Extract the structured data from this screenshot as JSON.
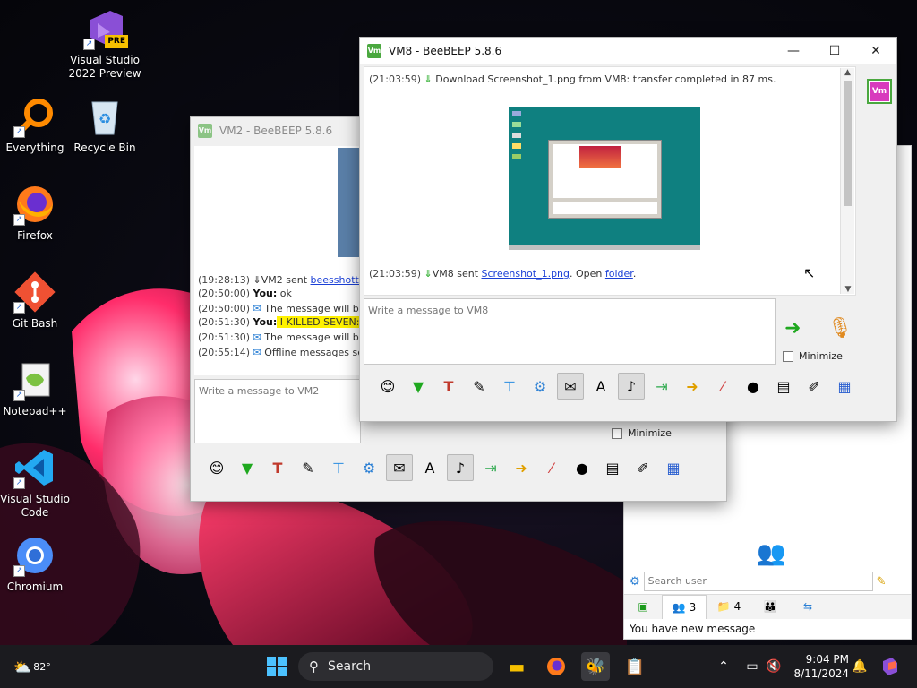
{
  "desktop": {
    "icons": [
      {
        "label": "Visual Studio 2022 Preview",
        "icon": "visual-studio-icon"
      },
      {
        "label": "Everything",
        "icon": "everything-search-icon"
      },
      {
        "label": "Recycle Bin",
        "icon": "recycle-bin-icon"
      },
      {
        "label": "Firefox",
        "icon": "firefox-icon"
      },
      {
        "label": "Git Bash",
        "icon": "git-bash-icon"
      },
      {
        "label": "Notepad++",
        "icon": "notepadpp-icon"
      },
      {
        "label": "Visual Studio Code",
        "icon": "vscode-icon"
      },
      {
        "label": "Chromium",
        "icon": "chromium-icon"
      }
    ],
    "vs_badge": "PRE"
  },
  "vm2_window": {
    "title": "VM2 - BeeBEEP 5.8.6",
    "messages": [
      {
        "time": "(19:28:13)",
        "prefix": "VM2 sent ",
        "link": "beesshottmp"
      },
      {
        "time": "(20:50:00)",
        "you": "You:",
        "text": " ok"
      },
      {
        "time": "(20:50:00)",
        "text": "The message will be de"
      },
      {
        "time": "(20:51:30)",
        "you": "You:",
        "highlight": " I KILLED SEVEN:50 C"
      },
      {
        "time": "(20:51:30)",
        "text": "The message will be de"
      },
      {
        "time": "(20:55:14)",
        "text": "Offline messages sent"
      }
    ],
    "input_placeholder": "Write a message to VM2",
    "minimize_label": "Minimize"
  },
  "vm8_window": {
    "title": "VM8 - BeeBEEP 5.8.6",
    "app_badge": "Vm",
    "controls": {
      "minimize": "—",
      "maximize": "☐",
      "close": "✕"
    },
    "messages": [
      {
        "time": "(21:03:59)",
        "text": "Download Screenshot_1.png from VM8: transfer completed in 87 ms."
      },
      {
        "time": "(21:03:59)",
        "prefix": "VM8 sent ",
        "link": "Screenshot_1.png",
        "middle": ". Open ",
        "link2": "folder",
        "suffix": "."
      }
    ],
    "input_placeholder": "Write a message to VM8",
    "minimize_label": "Minimize",
    "toolbar": [
      "smiley-icon",
      "green-arrow-down-icon",
      "text-format-icon",
      "color-pen-icon",
      "paint-brush-icon",
      "settings-gear-icon",
      "envelope-icon",
      "font-icon",
      "note-icon",
      "send-file-icon",
      "folder-icon",
      "html-tag-icon",
      "webcam-icon",
      "screenshot-icon",
      "notes-icon",
      "save-icon"
    ]
  },
  "main_panel": {
    "search_placeholder": "Search user",
    "tabs": [
      {
        "icon": "chat-icon",
        "label": ""
      },
      {
        "icon": "users-icon",
        "label": "3"
      },
      {
        "icon": "groups-icon",
        "label": "4"
      },
      {
        "icon": "network-icon",
        "label": ""
      },
      {
        "icon": "share-icon",
        "label": ""
      }
    ],
    "status": "You have new message"
  },
  "taskbar": {
    "weather_temp": "82°",
    "search_label": "Search",
    "time": "9:04 PM",
    "date": "8/11/2024"
  }
}
